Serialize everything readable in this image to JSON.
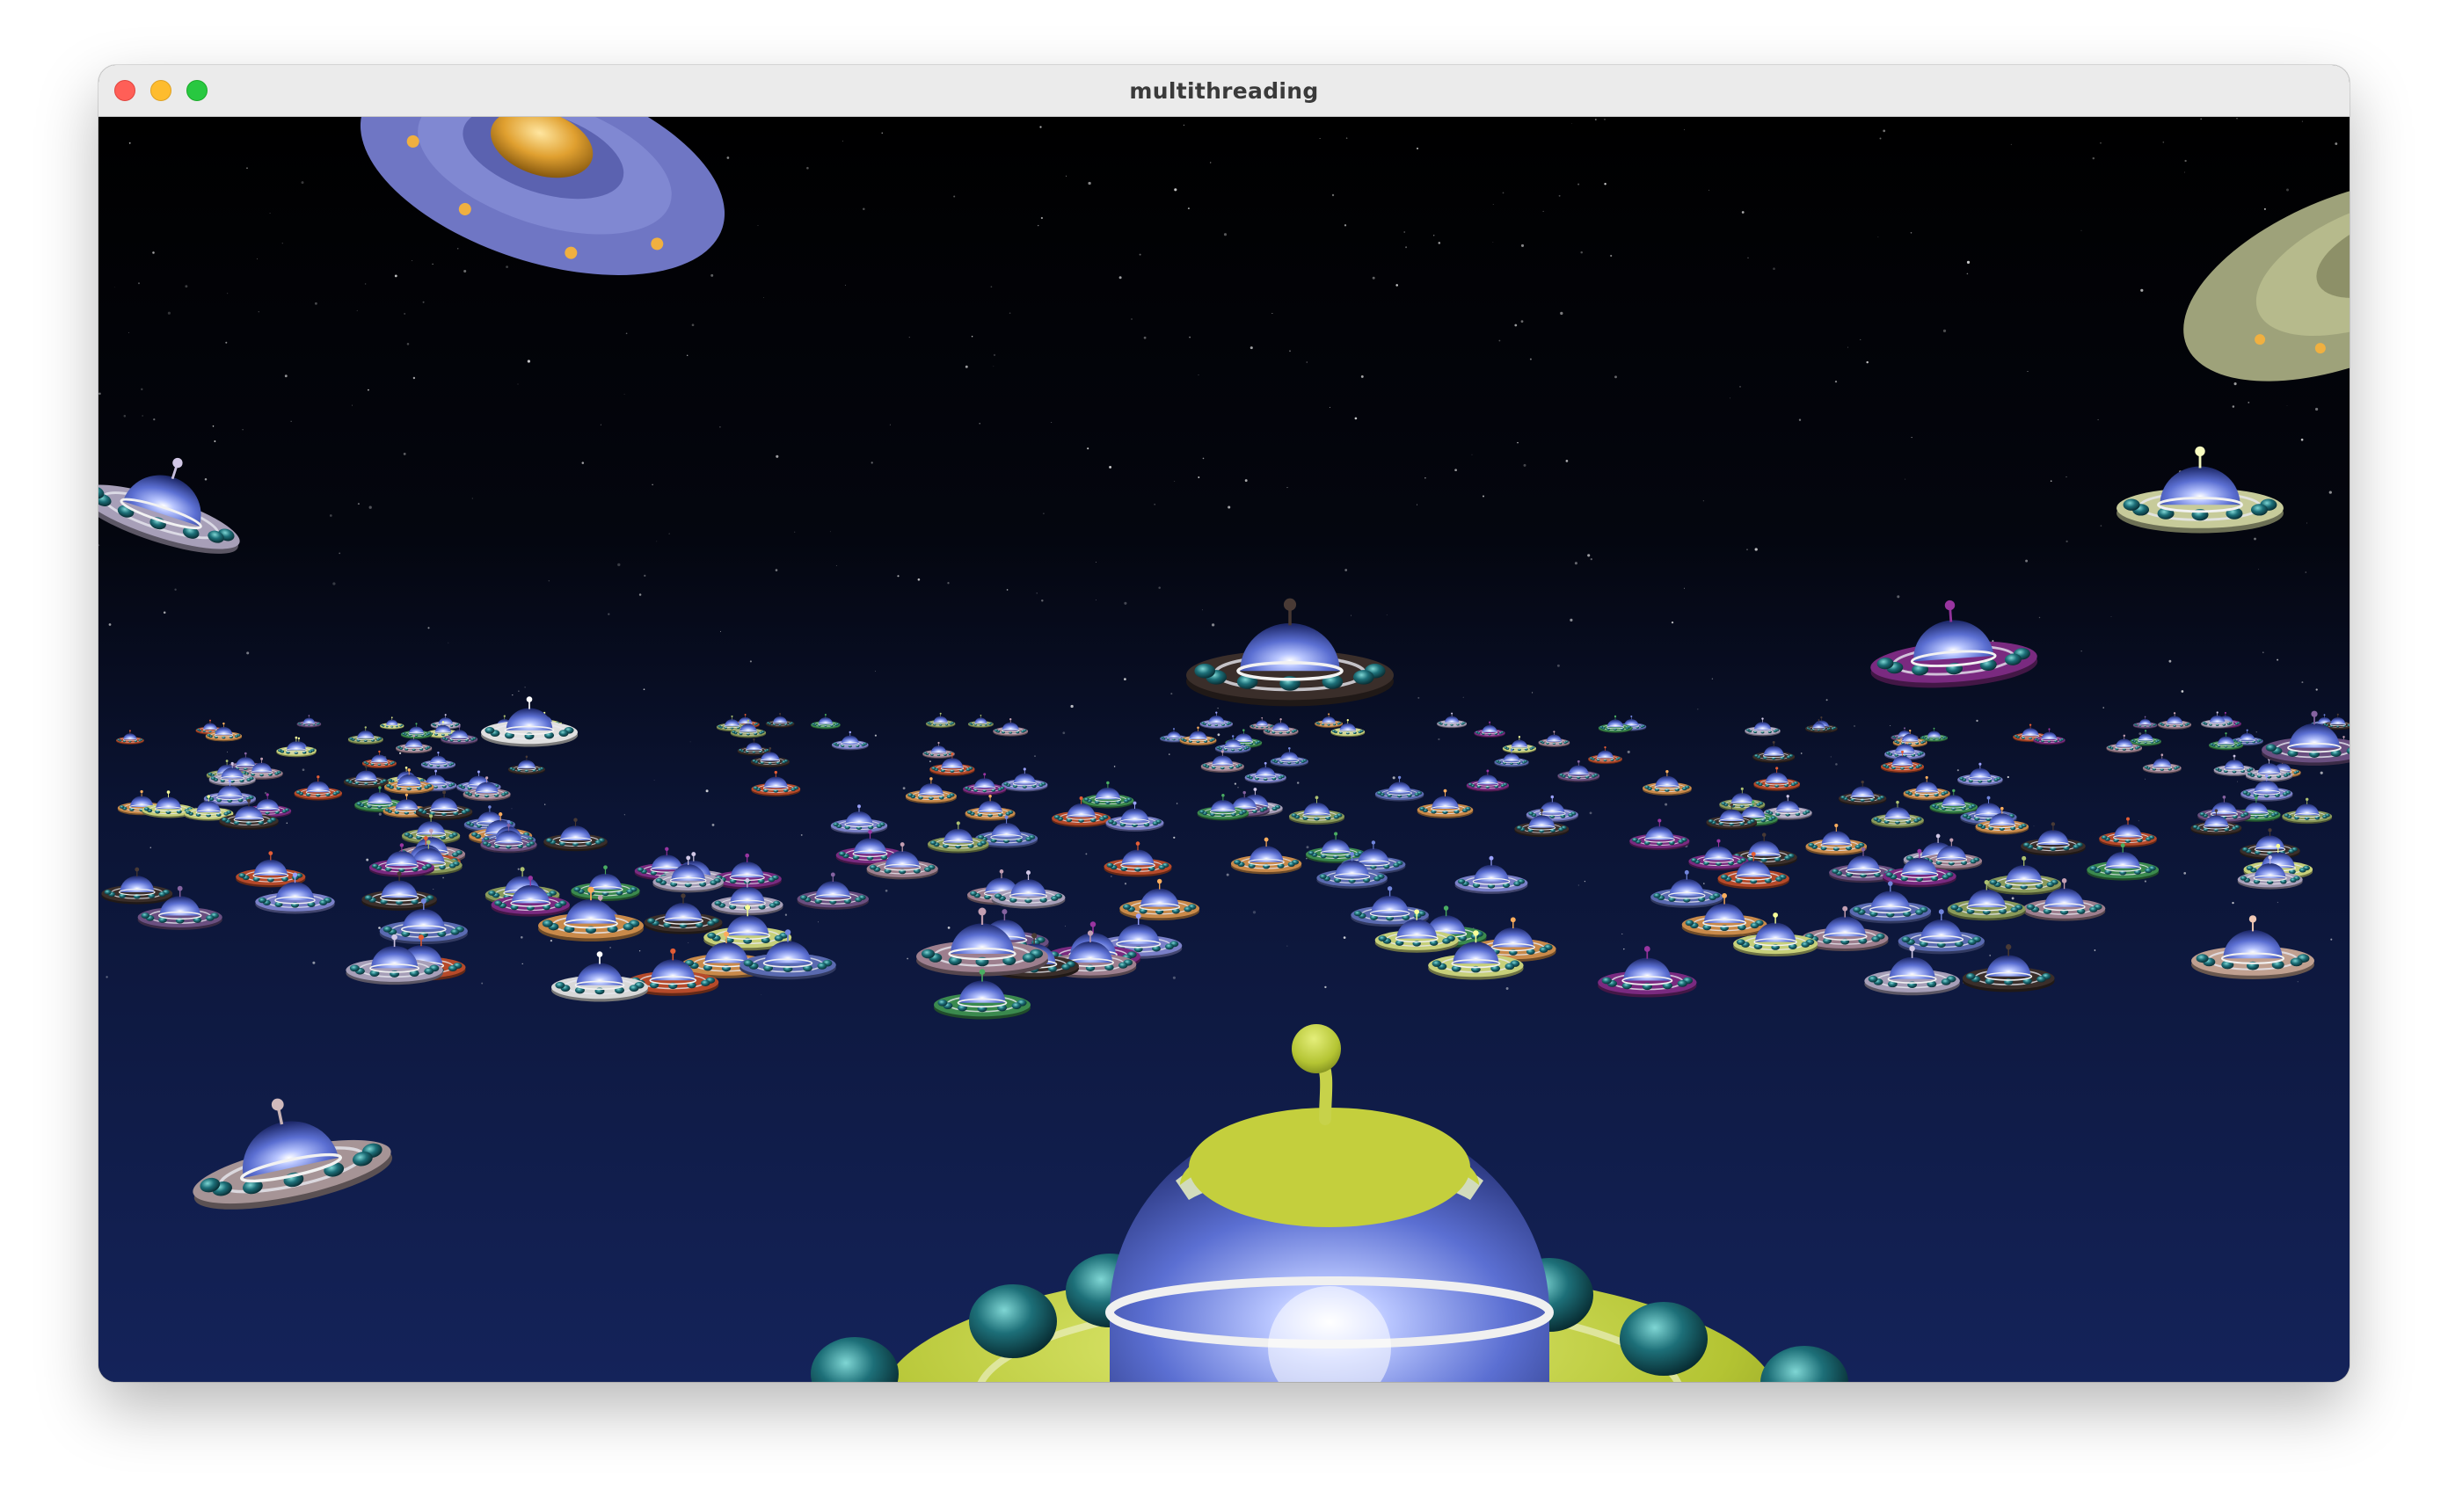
{
  "window": {
    "title": "multithreading"
  },
  "controls": {
    "close": "close-button",
    "minimize": "minimize-button",
    "maximize": "maximize-button"
  },
  "scene": {
    "background_top": "#000000",
    "background_bottom": "#14235a",
    "ufo_body_colors": [
      "#7a80c8",
      "#c7d07a",
      "#a79fb8",
      "#3a2e2a",
      "#7a2a80",
      "#c98a4a",
      "#9d7f8e",
      "#3b8a4e",
      "#b64a2a",
      "#5a6ab0",
      "#8a9a5a",
      "#6a4f80"
    ]
  }
}
